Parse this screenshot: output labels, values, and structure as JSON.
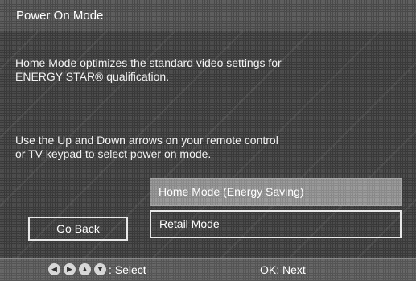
{
  "title": "Power On Mode",
  "description": {
    "line1": "Home Mode optimizes the standard video settings for",
    "line2": "ENERGY STAR® qualification.",
    "line3": "Use the Up and Down arrows on your remote control",
    "line4": "or TV keypad to select power on mode."
  },
  "options": [
    {
      "label": "Home Mode (Energy Saving)",
      "highlighted": true
    },
    {
      "label": "Retail Mode",
      "highlighted": false
    }
  ],
  "go_back_label": "Go Back",
  "footer": {
    "arrow_icons": [
      {
        "name": "arrow-left-icon",
        "glyph": "◀"
      },
      {
        "name": "arrow-right-icon",
        "glyph": "▶"
      },
      {
        "name": "arrow-up-icon",
        "glyph": "▲"
      },
      {
        "name": "arrow-down-icon",
        "glyph": "▼"
      }
    ],
    "select_label": ": Select",
    "ok_label": "OK: Next"
  },
  "colors": {
    "background": "#3a3a3a",
    "highlight": "#8a8a8a",
    "text": "#ffffff"
  }
}
